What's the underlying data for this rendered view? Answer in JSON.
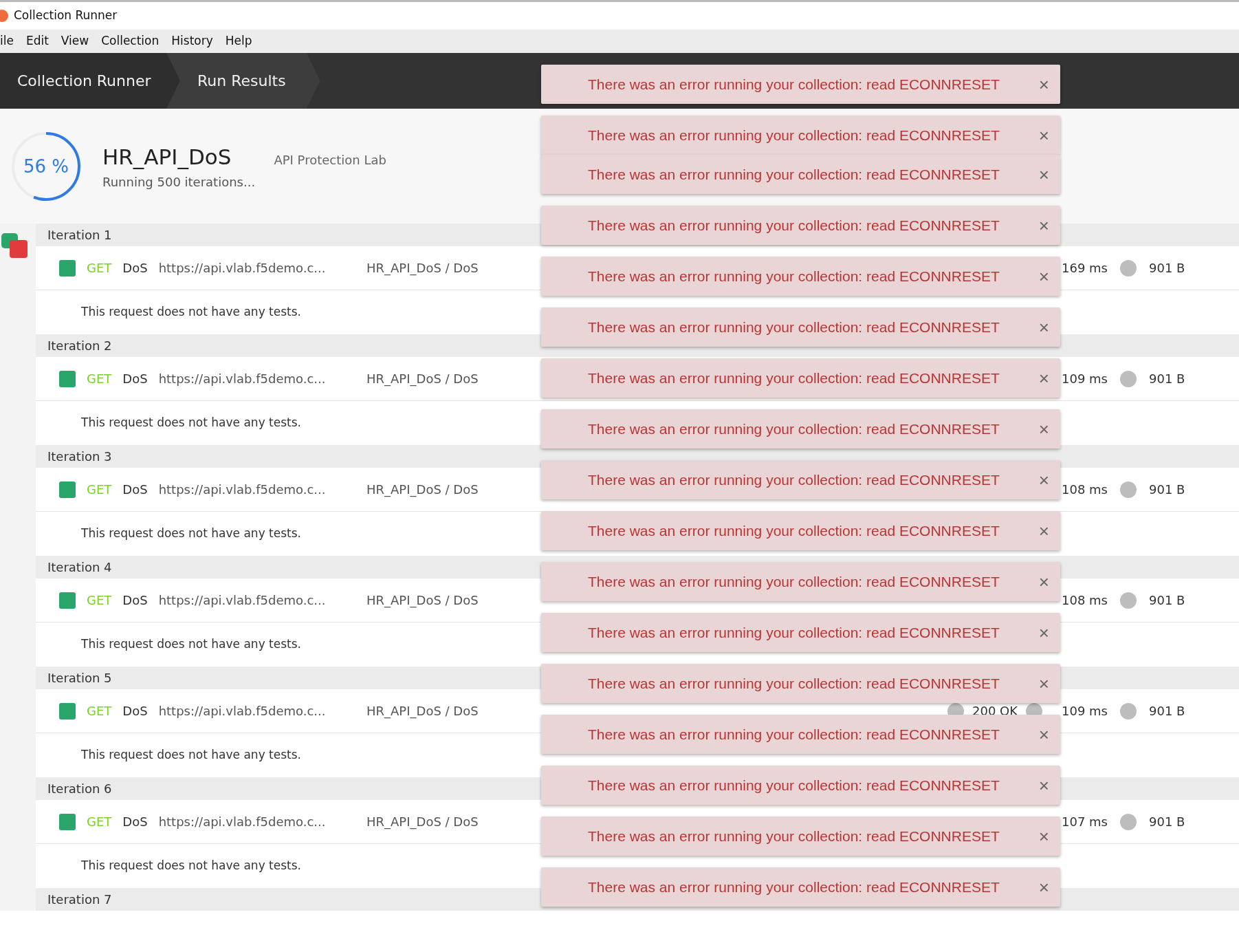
{
  "window": {
    "title": "Collection Runner"
  },
  "menu": [
    "ile",
    "Edit",
    "View",
    "Collection",
    "History",
    "Help"
  ],
  "breadcrumbs": [
    {
      "label": "Collection Runner",
      "selected": false
    },
    {
      "label": "Run Results",
      "selected": true
    }
  ],
  "run": {
    "percent": "56 %",
    "level": 0.56,
    "name": "HR_API_DoS",
    "environment": "API Protection Lab",
    "status": "Running 500 iterations..."
  },
  "iterations": [
    {
      "label": "Iteration 1",
      "request": {
        "method": "GET",
        "name": "DoS",
        "url": "https://api.vlab.f5demo.c...",
        "path": "HR_API_DoS / DoS",
        "time": "169 ms",
        "size": "901 B"
      },
      "tests": "This request does not have any tests."
    },
    {
      "label": "Iteration 2",
      "request": {
        "method": "GET",
        "name": "DoS",
        "url": "https://api.vlab.f5demo.c...",
        "path": "HR_API_DoS / DoS",
        "time": "109 ms",
        "size": "901 B"
      },
      "tests": "This request does not have any tests."
    },
    {
      "label": "Iteration 3",
      "request": {
        "method": "GET",
        "name": "DoS",
        "url": "https://api.vlab.f5demo.c...",
        "path": "HR_API_DoS / DoS",
        "time": "108 ms",
        "size": "901 B"
      },
      "tests": "This request does not have any tests."
    },
    {
      "label": "Iteration 4",
      "request": {
        "method": "GET",
        "name": "DoS",
        "url": "https://api.vlab.f5demo.c...",
        "path": "HR_API_DoS / DoS",
        "time": "108 ms",
        "size": "901 B"
      },
      "tests": "This request does not have any tests."
    },
    {
      "label": "Iteration 5",
      "request": {
        "method": "GET",
        "name": "DoS",
        "url": "https://api.vlab.f5demo.c...",
        "path": "HR_API_DoS / DoS",
        "status": "200 OK",
        "time": "109 ms",
        "size": "901 B"
      },
      "tests": "This request does not have any tests."
    },
    {
      "label": "Iteration 6",
      "request": {
        "method": "GET",
        "name": "DoS",
        "url": "https://api.vlab.f5demo.c...",
        "path": "HR_API_DoS / DoS",
        "time": "107 ms",
        "size": "901 B"
      },
      "tests": "This request does not have any tests."
    },
    {
      "label": "Iteration 7"
    }
  ],
  "toasts": [
    {
      "message": "There was an error running your collection: read ECONNRESET",
      "close": "×"
    },
    {
      "message": "There was an error running your collection: read ECONNRESET",
      "close": "×"
    },
    {
      "message": "There was an error running your collection: read ECONNRESET",
      "close": "×"
    },
    {
      "message": "There was an error running your collection: read ECONNRESET",
      "close": "×"
    },
    {
      "message": "There was an error running your collection: read ECONNRESET",
      "close": "×"
    },
    {
      "message": "There was an error running your collection: read ECONNRESET",
      "close": "×"
    },
    {
      "message": "There was an error running your collection: read ECONNRESET",
      "close": "×"
    },
    {
      "message": "There was an error running your collection: read ECONNRESET",
      "close": "×"
    },
    {
      "message": "There was an error running your collection: read ECONNRESET",
      "close": "×"
    },
    {
      "message": "There was an error running your collection: read ECONNRESET",
      "close": "×"
    },
    {
      "message": "There was an error running your collection: read ECONNRESET",
      "close": "×"
    },
    {
      "message": "There was an error running your collection: read ECONNRESET",
      "close": "×"
    },
    {
      "message": "There was an error running your collection: read ECONNRESET",
      "close": "×"
    },
    {
      "message": "There was an error running your collection: read ECONNRESET",
      "close": "×"
    },
    {
      "message": "There was an error running your collection: read ECONNRESET",
      "close": "×"
    },
    {
      "message": "There was an error running your collection: read ECONNRESET",
      "close": "×"
    },
    {
      "message": "There was an error running your collection: read ECONNRESET",
      "close": "×"
    }
  ]
}
